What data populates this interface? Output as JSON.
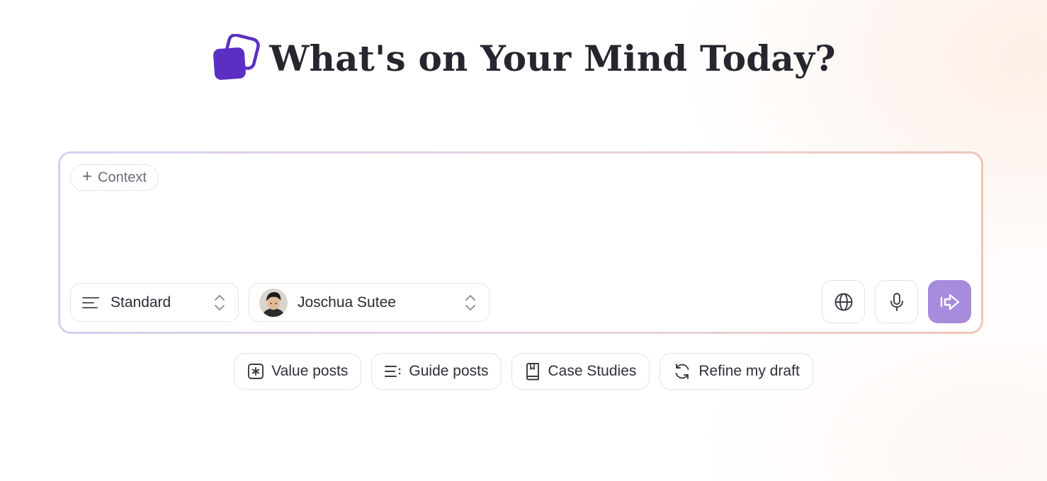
{
  "header": {
    "logo_icon": "stacked-squares-logo-icon",
    "title": "What's on Your Mind Today?"
  },
  "composer": {
    "context_chip": {
      "icon": "plus-icon",
      "plus": "+",
      "label": "Context"
    },
    "mode_select": {
      "icon": "align-left-lines-icon",
      "value": "Standard",
      "chevron_icon": "chevron-up-down-icon"
    },
    "author_select": {
      "avatar": "avatar",
      "value": "Joschua Sutee",
      "chevron_icon": "chevron-up-down-icon"
    },
    "actions": {
      "globe_icon": "globe-icon",
      "mic_icon": "microphone-icon",
      "send_icon": "send-arrow-icon"
    }
  },
  "suggestions": [
    {
      "icon": "asterisk-box-icon",
      "label": "Value posts"
    },
    {
      "icon": "list-icon",
      "label": "Guide posts"
    },
    {
      "icon": "book-icon",
      "label": "Case Studies"
    },
    {
      "icon": "refresh-icon",
      "label": "Refine my draft"
    }
  ],
  "colors": {
    "brand_purple": "#5b2fc2",
    "send_button": "#a78bdc",
    "text_dark": "#26262e",
    "border_gradient_start": "#d9cdf2",
    "border_gradient_end": "#efc6b7"
  }
}
